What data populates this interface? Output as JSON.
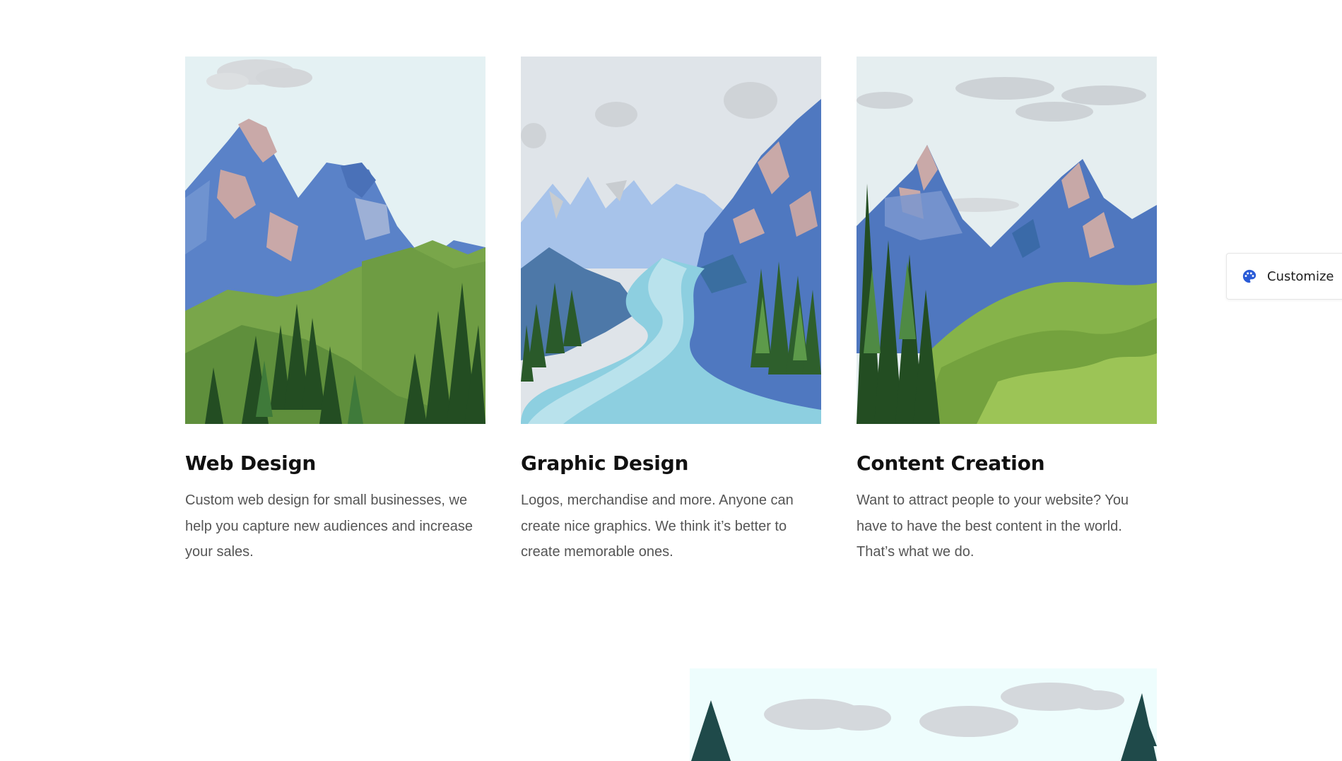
{
  "services": [
    {
      "title": "Web Design",
      "description": "Custom web design for small businesses, we help you capture new audiences and increase your sales.",
      "image_icon": "mountain-forest-illustration"
    },
    {
      "title": "Graphic Design",
      "description": "Logos, merchandise and more. Anyone can create nice graphics. We think it’s better to create memorable ones.",
      "image_icon": "mountain-river-illustration"
    },
    {
      "title": "Content Creation",
      "description": "Want to attract people to your website? You have to have the best content in the world. That’s what we do.",
      "image_icon": "mountain-meadow-illustration"
    }
  ],
  "customize": {
    "label": "Customize",
    "icon": "palette-icon",
    "icon_color": "#2a5bd7"
  },
  "colors": {
    "title": "#111111",
    "body_text": "#555555"
  }
}
